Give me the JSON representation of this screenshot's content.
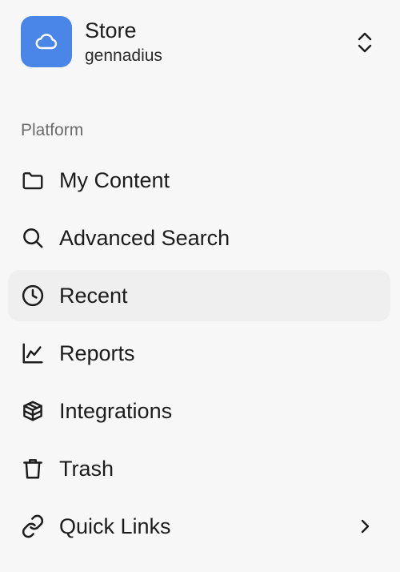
{
  "workspace": {
    "name": "Store",
    "user": "gennadius",
    "logo_icon": "cloud-icon",
    "logo_color": "#4a86e8"
  },
  "section": {
    "label": "Platform"
  },
  "nav": {
    "items": [
      {
        "label": "My Content",
        "icon": "folder-icon",
        "active": false
      },
      {
        "label": "Advanced Search",
        "icon": "search-icon",
        "active": false
      },
      {
        "label": "Recent",
        "icon": "clock-icon",
        "active": true
      },
      {
        "label": "Reports",
        "icon": "line-chart-icon",
        "active": false
      },
      {
        "label": "Integrations",
        "icon": "box-icon",
        "active": false
      },
      {
        "label": "Trash",
        "icon": "trash-icon",
        "active": false
      },
      {
        "label": "Quick Links",
        "icon": "link-icon",
        "active": false,
        "has_submenu": true
      }
    ]
  }
}
